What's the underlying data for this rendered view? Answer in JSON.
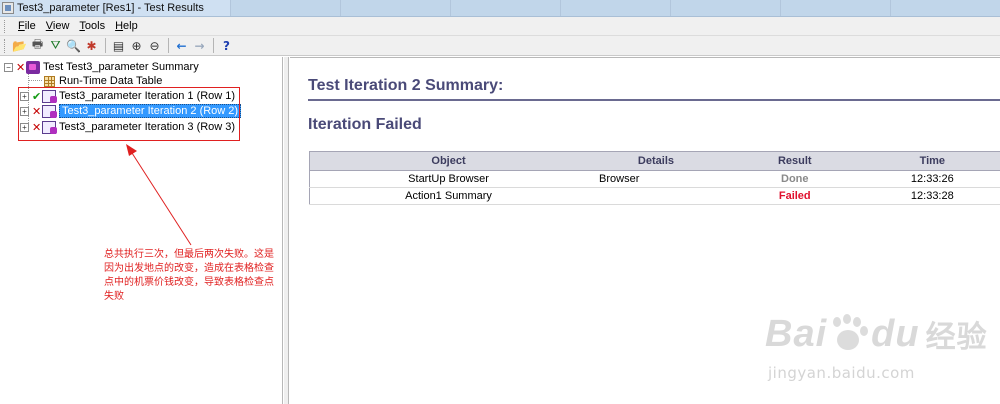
{
  "window": {
    "title": "Test3_parameter [Res1] - Test Results"
  },
  "menu": {
    "items": [
      {
        "label": "File",
        "accel": "F",
        "rest": "ile"
      },
      {
        "label": "View",
        "accel": "V",
        "rest": "iew"
      },
      {
        "label": "Tools",
        "accel": "T",
        "rest": "ools"
      },
      {
        "label": "Help",
        "accel": "H",
        "rest": "elp"
      }
    ]
  },
  "toolbar": {
    "buttons": [
      {
        "name": "open-icon",
        "glyph": "📂"
      },
      {
        "name": "print-icon",
        "glyph": "🖶"
      },
      {
        "name": "filter-icon",
        "glyph": "⛛"
      },
      {
        "name": "find-icon",
        "glyph": "🔍"
      },
      {
        "name": "bug-icon",
        "glyph": "✱"
      },
      {
        "name": "preview-icon",
        "glyph": "▤"
      },
      {
        "name": "zoom-in-icon",
        "glyph": "⊕"
      },
      {
        "name": "zoom-out-icon",
        "glyph": "⊖"
      },
      {
        "name": "back-arrow-icon",
        "glyph": "←"
      },
      {
        "name": "forward-arrow-icon",
        "glyph": "→"
      },
      {
        "name": "help-icon",
        "glyph": "?"
      }
    ],
    "colors": {
      "arrow": "#1f6fd1",
      "help": "#1f3fb0",
      "filter": "#1f7a2a",
      "bug": "#c0392b"
    }
  },
  "tree": {
    "root": {
      "label": "Test Test3_parameter Summary",
      "status": "failed"
    },
    "data_table": {
      "label": "Run-Time Data Table"
    },
    "iterations": [
      {
        "label": "Test3_parameter Iteration 1 (Row 1)",
        "status": "passed",
        "selected": false
      },
      {
        "label": "Test3_parameter Iteration 2 (Row 2)",
        "status": "failed",
        "selected": true
      },
      {
        "label": "Test3_parameter Iteration 3 (Row 3)",
        "status": "failed",
        "selected": false
      }
    ],
    "expander_glyph": "+",
    "collapse_glyph": "−"
  },
  "annotation": {
    "text": "总共执行三次，但最后两次失败。这是因为出发地点的改变，造成在表格检查点中的机票价钱改变，导致表格检查点失败",
    "color": "#e02020"
  },
  "summary": {
    "title": "Test Iteration 2 Summary:",
    "status": "Iteration Failed",
    "table": {
      "headers": [
        "Object",
        "Details",
        "Result",
        "Time"
      ],
      "rows": [
        {
          "object": "StartUp Browser",
          "details": "Browser",
          "result": "Done",
          "time": "12:33:26"
        },
        {
          "object": "Action1 Summary",
          "details": "",
          "result": "Failed",
          "time": "12:33:28"
        }
      ]
    }
  },
  "watermark": {
    "logo_text": "Bai",
    "logo_text_2": "du",
    "cn_text": "经验",
    "url": "jingyan.baidu.com"
  }
}
